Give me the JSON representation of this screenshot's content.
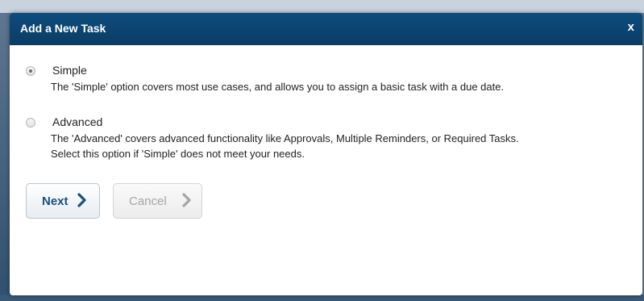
{
  "dialog": {
    "title": "Add a New Task",
    "close_label": "x"
  },
  "options": {
    "simple": {
      "label": "Simple",
      "description": "The 'Simple' option covers most use cases, and allows you to assign a basic task with a due date.",
      "selected": true
    },
    "advanced": {
      "label": "Advanced",
      "description_line1": "The 'Advanced' covers advanced functionality like Approvals, Multiple Reminders, or Required Tasks.",
      "description_line2": "Select this option if 'Simple' does not meet your needs.",
      "selected": false
    }
  },
  "buttons": {
    "next_label": "Next",
    "cancel_label": "Cancel",
    "next_icon": "chevron-right-icon",
    "cancel_icon": "chevron-right-icon"
  },
  "colors": {
    "titlebar": "#0d4c7e",
    "next_text": "#1a4f7f",
    "cancel_text": "#a5a5a5"
  }
}
